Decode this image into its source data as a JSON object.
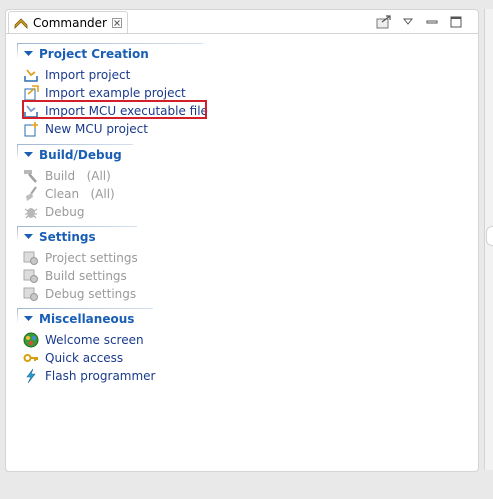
{
  "tab": {
    "title": "Commander",
    "close_glyph": "☒"
  },
  "toolbar": {
    "icons": [
      "open-perspective-icon",
      "view-menu-icon",
      "minimize-icon",
      "maximize-icon"
    ]
  },
  "sections": [
    {
      "title": "Project Creation",
      "items": [
        {
          "label": "Import project",
          "icon": "import-project-icon",
          "enabled": true
        },
        {
          "label": "Import example project",
          "icon": "import-example-icon",
          "enabled": true
        },
        {
          "label": "Import MCU executable file",
          "icon": "import-mcu-icon",
          "enabled": true,
          "highlighted": true
        },
        {
          "label": "New MCU project",
          "icon": "new-project-icon",
          "enabled": true
        }
      ]
    },
    {
      "title": "Build/Debug",
      "items": [
        {
          "label": "Build   (All)",
          "icon": "hammer-icon",
          "enabled": false
        },
        {
          "label": "Clean   (All)",
          "icon": "broom-icon",
          "enabled": false
        },
        {
          "label": "Debug",
          "icon": "bug-icon",
          "enabled": false
        }
      ]
    },
    {
      "title": "Settings",
      "items": [
        {
          "label": "Project settings",
          "icon": "project-settings-icon",
          "enabled": false
        },
        {
          "label": "Build settings",
          "icon": "build-settings-icon",
          "enabled": false
        },
        {
          "label": "Debug settings",
          "icon": "debug-settings-icon",
          "enabled": false
        }
      ]
    },
    {
      "title": "Miscellaneous",
      "items": [
        {
          "label": "Welcome screen",
          "icon": "welcome-icon",
          "enabled": true
        },
        {
          "label": "Quick access",
          "icon": "key-icon",
          "enabled": true
        },
        {
          "label": "Flash programmer",
          "icon": "lightning-icon",
          "enabled": true
        }
      ]
    }
  ],
  "colors": {
    "section_title": "#1a5fb4",
    "link": "#1a3a8c",
    "disabled": "#9a9a9a",
    "highlight": "#d31f2a"
  }
}
